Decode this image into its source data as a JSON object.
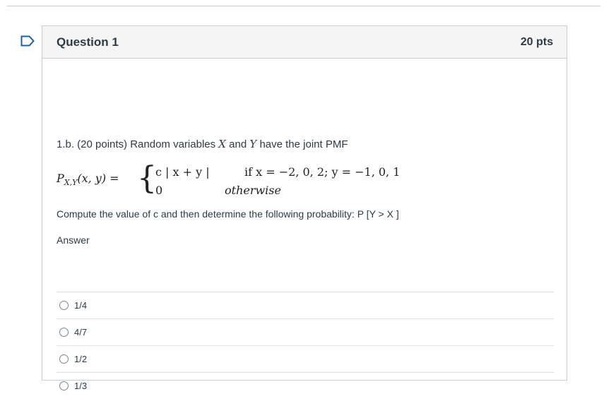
{
  "question": {
    "title": "Question 1",
    "points": "20 pts",
    "prompt_prefix": "1.b. (20 points) Random variables ",
    "var_x": "X",
    "prompt_and": "and ",
    "var_y": "Y",
    "prompt_suffix": "have the joint PMF",
    "formula": {
      "lhs": "P",
      "lhs_sub": "X,Y",
      "lhs_args": "(x, y) =",
      "case1_expr": "c | x + y |",
      "case1_cond": "if x = −2, 0, 2;  y = −1, 0, 1",
      "case2_expr": "0",
      "case2_cond": "otherwise"
    },
    "compute_text": "Compute the value of c and then determine the following probability: P [Y > X ]",
    "answer_label": "Answer",
    "options": [
      "1/4",
      "4/7",
      "1/2",
      "1/3"
    ]
  },
  "icons": {
    "flag": "bookmark-flag-icon",
    "radio": "radio-button-icon"
  },
  "colors": {
    "border": "#c7cdd1",
    "header_bg": "#f5f5f5",
    "text": "#2d3b45",
    "flag": "#1f5fa8"
  }
}
